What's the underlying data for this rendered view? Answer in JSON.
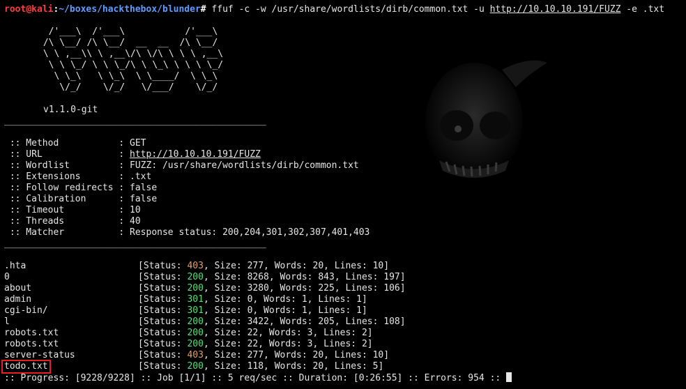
{
  "prompt": {
    "user": "root",
    "at": "@",
    "host": "kali",
    "sep": ":",
    "path": "~/boxes/hackthebox/blunder",
    "symbol": "#"
  },
  "command": {
    "before_url": " ffuf -c -w /usr/share/wordlists/dirb/common.txt -u ",
    "url": "http://10.10.10.191/FUZZ",
    "after_url": " -e .txt"
  },
  "banner": {
    "ascii_lines": [
      "  /'___\\  /'___\\           /'___\\",
      " /\\ \\__/ /\\ \\__/  __  __  /\\ \\__/",
      " \\ \\ ,__\\\\ \\ ,__\\/\\ \\/\\ \\ \\ \\ ,__\\",
      "  \\ \\ \\_/ \\ \\ \\_/\\ \\ \\_\\ \\ \\ \\ \\_/",
      "   \\ \\_\\   \\ \\_\\  \\ \\____/  \\ \\_\\",
      "    \\/_/    \\/_/   \\/___/    \\/_/"
    ],
    "version": "v1.1.0-git"
  },
  "separator": "________________________________________________",
  "config": [
    {
      "key": " :: Method           : ",
      "value": "GET"
    },
    {
      "key": " :: URL              : ",
      "value": "http://10.10.10.191/FUZZ"
    },
    {
      "key": " :: Wordlist         : ",
      "value": "FUZZ: /usr/share/wordlists/dirb/common.txt"
    },
    {
      "key": " :: Extensions       : ",
      "value": ".txt"
    },
    {
      "key": " :: Follow redirects : ",
      "value": "false"
    },
    {
      "key": " :: Calibration      : ",
      "value": "false"
    },
    {
      "key": " :: Timeout          : ",
      "value": "10"
    },
    {
      "key": " :: Threads          : ",
      "value": "40"
    },
    {
      "key": " :: Matcher          : ",
      "value": "Response status: 200,204,301,302,307,401,403"
    }
  ],
  "results": [
    {
      "name": ".hta",
      "status": "403",
      "size": "277",
      "words": "20",
      "lines": "10"
    },
    {
      "name": "0",
      "status": "200",
      "size": "8268",
      "words": "843",
      "lines": "197"
    },
    {
      "name": "about",
      "status": "200",
      "size": "3280",
      "words": "225",
      "lines": "106"
    },
    {
      "name": "admin",
      "status": "301",
      "size": "0",
      "words": "1",
      "lines": "1"
    },
    {
      "name": "cgi-bin/",
      "status": "301",
      "size": "0",
      "words": "1",
      "lines": "1"
    },
    {
      "name": "l",
      "status": "200",
      "size": "3422",
      "words": "205",
      "lines": "108"
    },
    {
      "name": "robots.txt",
      "status": "200",
      "size": "22",
      "words": "3",
      "lines": "2"
    },
    {
      "name": "robots.txt",
      "status": "200",
      "size": "22",
      "words": "3",
      "lines": "2"
    },
    {
      "name": "server-status",
      "status": "403",
      "size": "277",
      "words": "20",
      "lines": "10"
    },
    {
      "name": "todo.txt",
      "status": "200",
      "size": "118",
      "words": "20",
      "lines": "5"
    }
  ],
  "progress_line": ":: Progress: [9228/9228] :: Job [1/1] :: 5 req/sec :: Duration: [0:26:55] :: Errors: 954 ::",
  "colors": {
    "status_200": "#4fe07a",
    "status_301": "#4fe07a",
    "status_403": "#e1a25a",
    "prompt_user": "#ff3b3b",
    "prompt_path": "#5f9bff",
    "highlight_box": "#e52020"
  }
}
